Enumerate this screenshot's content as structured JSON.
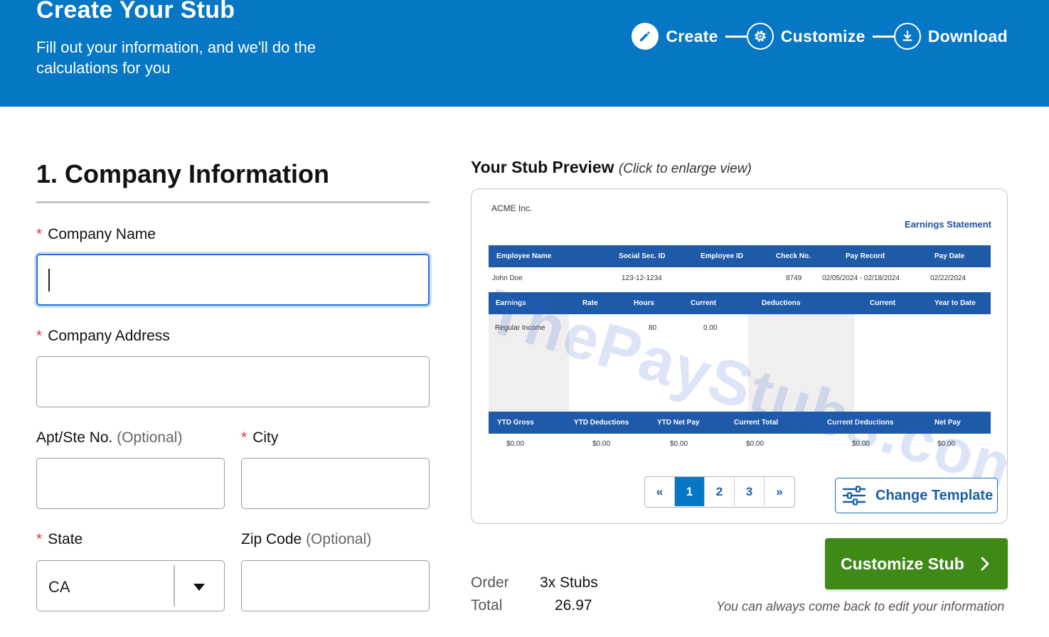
{
  "header": {
    "title": "Create Your Stub",
    "subtitle": "Fill out your information, and we'll do the calculations for you",
    "steps": [
      {
        "label": "Create",
        "icon": "pencil-icon"
      },
      {
        "label": "Customize",
        "icon": "gear-icon"
      },
      {
        "label": "Download",
        "icon": "download-icon"
      }
    ]
  },
  "form": {
    "section_title": "1. Company Information",
    "company_name_label": "Company Name",
    "company_name_value": "",
    "company_address_label": "Company Address",
    "company_address_value": "",
    "apt_label": "Apt/Ste No.",
    "apt_optional": "(Optional)",
    "apt_value": "",
    "city_label": "City",
    "city_value": "",
    "state_label": "State",
    "state_value": "CA",
    "zip_label": "Zip Code",
    "zip_optional": "(Optional)",
    "zip_value": "",
    "required_marker": "*"
  },
  "preview": {
    "title": "Your Stub Preview",
    "hint": "(Click to enlarge view)",
    "stub": {
      "company": "ACME Inc.",
      "heading": "Earnings Statement",
      "watermark": "ThePayStubs.com",
      "info_headers": [
        "Employee Name",
        "Social Sec. ID",
        "Employee ID",
        "Check No.",
        "Pay Record",
        "Pay Date"
      ],
      "info_values": [
        "John Doe",
        "123-12-1234",
        "",
        "8749",
        "02/05/2024 - 02/18/2024",
        "02/22/2024"
      ],
      "earn_headers": [
        "Earnings",
        "Rate",
        "Hours",
        "Current",
        "Deductions",
        "Current",
        "Year to Date"
      ],
      "earn_row": {
        "label": "Regular Income",
        "hours": "80",
        "current": "0.00"
      },
      "total_headers": [
        "YTD Gross",
        "YTD Deductions",
        "YTD Net Pay",
        "Current Total",
        "Current Deductions",
        "Net Pay"
      ],
      "total_values": [
        "$0.00",
        "$0.00",
        "$0.00",
        "$0.00",
        "$0.00",
        "$0.00"
      ]
    },
    "pager": {
      "prev": "«",
      "pages": [
        "1",
        "2",
        "3"
      ],
      "next": "»",
      "active": "1"
    },
    "change_template_label": "Change Template"
  },
  "order": {
    "order_label": "Order",
    "order_value": "3x Stubs",
    "total_label": "Total",
    "total_value": "26.97"
  },
  "actions": {
    "customize_label": "Customize Stub",
    "note": "You can always come back to edit your information"
  },
  "colors": {
    "brand_blue": "#0677c4",
    "stub_blue": "#1f5aa8",
    "cta_green": "#3f8a16",
    "required_red": "#e5333a"
  }
}
